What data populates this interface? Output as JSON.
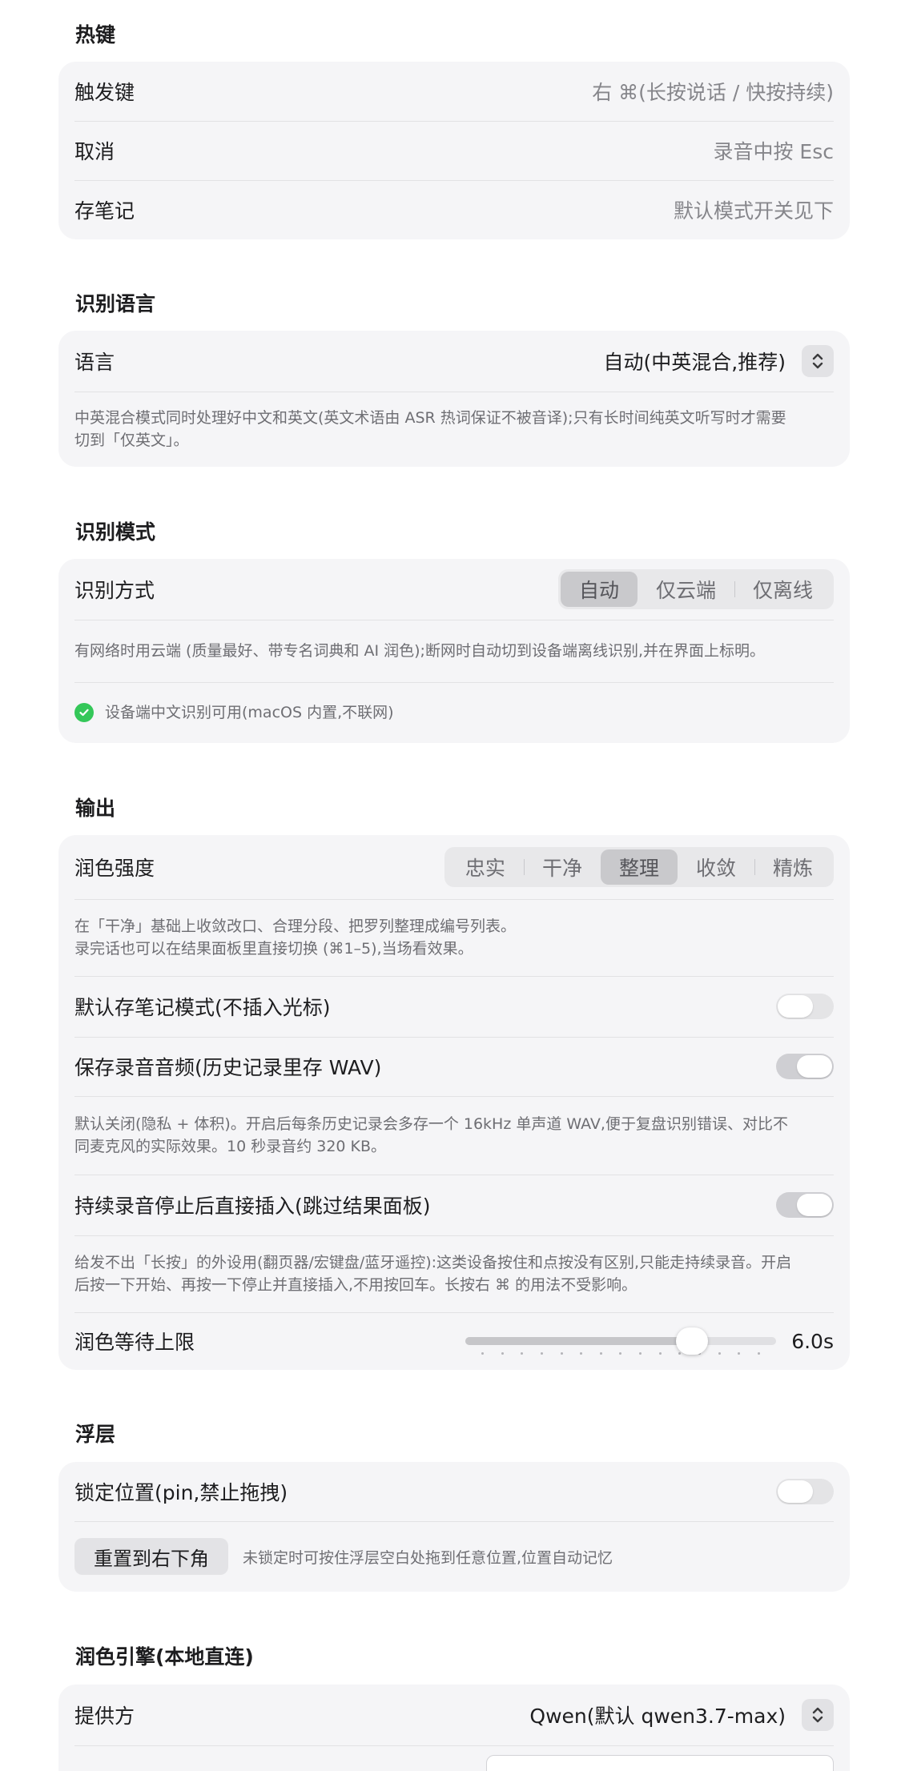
{
  "hotkeys": {
    "title": "热键",
    "rows": [
      {
        "label": "触发键",
        "value": "右 ⌘(长按说话 / 快按持续)"
      },
      {
        "label": "取消",
        "value": "录音中按 Esc"
      },
      {
        "label": "存笔记",
        "value": "默认模式开关见下"
      }
    ]
  },
  "language": {
    "title": "识别语言",
    "label": "语言",
    "selected": "自动(中英混合,推荐)",
    "note_lines": [
      "中英混合模式同时处理好中文和英文(英文术语由 ASR 热词保证不被音译);只有长时间纯英文听写时才需要",
      "切到「仅英文」。"
    ]
  },
  "mode": {
    "title": "识别模式",
    "label": "识别方式",
    "options": [
      "自动",
      "仅云端",
      "仅离线"
    ],
    "selected_index": 0,
    "note": "有网络时用云端 (质量最好、带专名词典和 AI 润色);断网时自动切到设备端离线识别,并在界面上标明。",
    "status": "设备端中文识别可用(macOS 内置,不联网)"
  },
  "output": {
    "title": "输出",
    "polish_label": "润色强度",
    "polish_options": [
      "忠实",
      "干净",
      "整理",
      "收敛",
      "精炼"
    ],
    "polish_selected_index": 2,
    "polish_note_lines": [
      "在「干净」基础上收敛改口、合理分段、把罗列整理成编号列表。",
      "录完话也可以在结果面板里直接切换 (⌘1–5),当场看效果。"
    ],
    "note_mode_label": "默认存笔记模式(不插入光标)",
    "note_mode_on": false,
    "save_audio_label": "保存录音音频(历史记录里存 WAV)",
    "save_audio_on": true,
    "save_audio_note_lines": [
      "默认关闭(隐私 + 体积)。开启后每条历史记录会多存一个 16kHz 单声道 WAV,便于复盘识别错误、对比不",
      "同麦克风的实际效果。10 秒录音约 320 KB。"
    ],
    "direct_insert_label": "持续录音停止后直接插入(跳过结果面板)",
    "direct_insert_on": true,
    "direct_insert_note_lines": [
      "给发不出「长按」的外设用(翻页器/宏键盘/蓝牙遥控):这类设备按住和点按没有区别,只能走持续录音。开启",
      "后按一下开始、再按一下停止并直接插入,不用按回车。长按右 ⌘ 的用法不受影响。"
    ],
    "timeout_label": "润色等待上限",
    "timeout_value": "6.0s",
    "timeout_fraction": 0.73
  },
  "overlay": {
    "title": "浮层",
    "lock_label": "锁定位置(pin,禁止拖拽)",
    "lock_on": false,
    "reset_button": "重置到右下角",
    "reset_hint": "未锁定时可按住浮层空白处拖到任意位置,位置自动记忆"
  },
  "engine": {
    "title": "润色引擎(本地直连)",
    "provider_label": "提供方",
    "provider_value": "Qwen(默认 qwen3.7-max)"
  }
}
